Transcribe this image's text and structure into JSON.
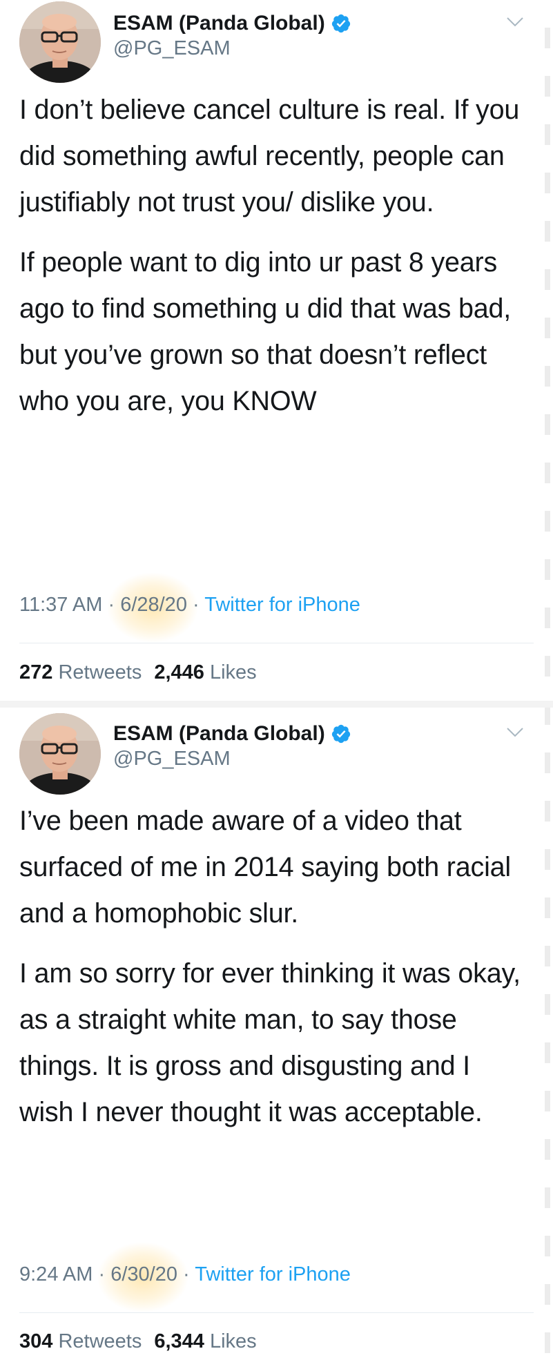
{
  "tweets": [
    {
      "author": {
        "display_name": "ESAM (Panda Global)",
        "handle": "@PG_ESAM",
        "verified": true
      },
      "paragraphs": [
        "I don’t believe cancel culture is real. If you did something awful recently, people can justifiably not trust you/ dislike you.",
        "If people want to dig into ur past 8 years ago to find something u did that was bad, but you’ve grown so that doesn’t reflect who you are, you KNOW"
      ],
      "time": "11:37 AM",
      "separator": "·",
      "date": "6/28/20",
      "client": "Twitter for iPhone",
      "retweets": "272",
      "retweets_label": "Retweets",
      "likes": "2,446",
      "likes_label": "Likes"
    },
    {
      "author": {
        "display_name": "ESAM (Panda Global)",
        "handle": "@PG_ESAM",
        "verified": true
      },
      "paragraphs": [
        "I’ve been made aware of a video that surfaced of me in 2014 saying both racial and a homophobic slur.",
        "I am so sorry for ever thinking it was okay, as a straight white man, to say those things. It is gross and disgusting and I wish I never thought it was acceptable."
      ],
      "time": "9:24 AM",
      "separator": "·",
      "date": "6/30/20",
      "client": "Twitter for iPhone",
      "retweets": "304",
      "retweets_label": "Retweets",
      "likes": "6,344",
      "likes_label": "Likes"
    }
  ],
  "colors": {
    "text": "#14171a",
    "secondary": "#657786",
    "link": "#1da1f2",
    "verified": "#1da1f2",
    "highlight": "#ffd678"
  },
  "icons": {
    "verified": "verified-badge-icon",
    "menu": "chevron-down-icon"
  }
}
